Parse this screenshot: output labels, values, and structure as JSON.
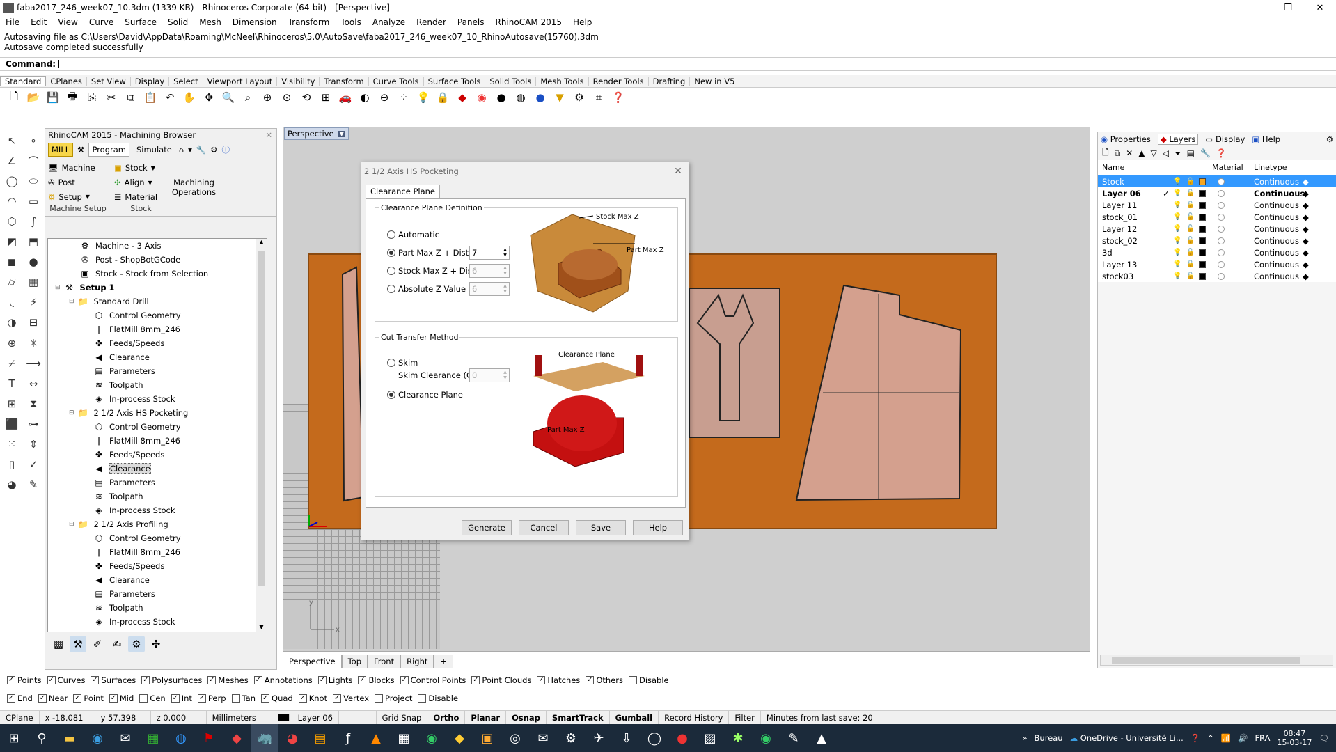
{
  "window": {
    "title": "faba2017_246_week07_10.3dm (1339 KB) - Rhinoceros Corporate (64-bit) - [Perspective]",
    "minimize": "—",
    "restore": "❐",
    "close": "✕"
  },
  "menu": [
    "File",
    "Edit",
    "View",
    "Curve",
    "Surface",
    "Solid",
    "Mesh",
    "Dimension",
    "Transform",
    "Tools",
    "Analyze",
    "Render",
    "Panels",
    "RhinoCAM 2015",
    "Help"
  ],
  "command_history": [
    "Autosaving file as C:\\Users\\David\\AppData\\Roaming\\McNeel\\Rhinoceros\\5.0\\AutoSave\\faba2017_246_week07_10_RhinoAutosave(15760).3dm",
    "Autosave completed successfully"
  ],
  "command_label": "Command:",
  "toolbar_tabs": [
    "Standard",
    "CPlanes",
    "Set View",
    "Display",
    "Select",
    "Viewport Layout",
    "Visibility",
    "Transform",
    "Curve Tools",
    "Surface Tools",
    "Solid Tools",
    "Mesh Tools",
    "Render Tools",
    "Drafting",
    "New in V5"
  ],
  "browser": {
    "title": "RhinoCAM 2015 - Machining Browser",
    "mill": "MILL",
    "program": "Program",
    "simulate": "Simulate",
    "machine": "Machine",
    "post": "Post",
    "setup": "Setup",
    "stock": "Stock",
    "align": "Align",
    "material": "Material",
    "machining_operations": "Machining Operations",
    "group_setup": "Machine Setup",
    "group_stock": "Stock"
  },
  "tree": [
    {
      "indent": 2,
      "icon": "machine-icon",
      "label": "Machine - 3 Axis",
      "glyph": "⚙"
    },
    {
      "indent": 2,
      "icon": "post-icon",
      "label": "Post - ShopBotGCode",
      "glyph": "✇"
    },
    {
      "indent": 2,
      "icon": "stock-icon",
      "label": "Stock - Stock from Selection",
      "glyph": "▣"
    },
    {
      "indent": 1,
      "icon": "setup-icon",
      "label": "Setup 1",
      "bold": true,
      "glyph": "⚒"
    },
    {
      "indent": 2,
      "icon": "folder-icon",
      "label": "Standard Drill",
      "glyph": "📁"
    },
    {
      "indent": 3,
      "icon": "control-geometry-icon",
      "label": "Control Geometry",
      "glyph": "⬡"
    },
    {
      "indent": 3,
      "icon": "tool-icon",
      "label": "FlatMill 8mm_246",
      "glyph": "ǀ"
    },
    {
      "indent": 3,
      "icon": "feeds-icon",
      "label": "Feeds/Speeds",
      "glyph": "✤"
    },
    {
      "indent": 3,
      "icon": "clearance-icon",
      "label": "Clearance",
      "glyph": "◀"
    },
    {
      "indent": 3,
      "icon": "parameters-icon",
      "label": "Parameters",
      "glyph": "▤"
    },
    {
      "indent": 3,
      "icon": "toolpath-icon",
      "label": "Toolpath",
      "glyph": "≋"
    },
    {
      "indent": 3,
      "icon": "inprocess-stock-icon",
      "label": "In-process Stock",
      "glyph": "◈"
    },
    {
      "indent": 2,
      "icon": "folder-icon",
      "label": "2 1/2 Axis HS Pocketing",
      "glyph": "📁"
    },
    {
      "indent": 3,
      "icon": "control-geometry-icon",
      "label": "Control Geometry",
      "glyph": "⬡"
    },
    {
      "indent": 3,
      "icon": "tool-icon",
      "label": "FlatMill 8mm_246",
      "glyph": "ǀ"
    },
    {
      "indent": 3,
      "icon": "feeds-icon",
      "label": "Feeds/Speeds",
      "glyph": "✤"
    },
    {
      "indent": 3,
      "icon": "clearance-icon",
      "label": "Clearance",
      "glyph": "◀",
      "selected": true
    },
    {
      "indent": 3,
      "icon": "parameters-icon",
      "label": "Parameters",
      "glyph": "▤"
    },
    {
      "indent": 3,
      "icon": "toolpath-icon",
      "label": "Toolpath",
      "glyph": "≋"
    },
    {
      "indent": 3,
      "icon": "inprocess-stock-icon",
      "label": "In-process Stock",
      "glyph": "◈"
    },
    {
      "indent": 2,
      "icon": "folder-icon",
      "label": "2 1/2 Axis Profiling",
      "glyph": "📁"
    },
    {
      "indent": 3,
      "icon": "control-geometry-icon",
      "label": "Control Geometry",
      "glyph": "⬡"
    },
    {
      "indent": 3,
      "icon": "tool-icon",
      "label": "FlatMill 8mm_246",
      "glyph": "ǀ"
    },
    {
      "indent": 3,
      "icon": "feeds-icon",
      "label": "Feeds/Speeds",
      "glyph": "✤"
    },
    {
      "indent": 3,
      "icon": "clearance-icon",
      "label": "Clearance",
      "glyph": "◀"
    },
    {
      "indent": 3,
      "icon": "parameters-icon",
      "label": "Parameters",
      "glyph": "▤"
    },
    {
      "indent": 3,
      "icon": "toolpath-icon",
      "label": "Toolpath",
      "glyph": "≋"
    },
    {
      "indent": 3,
      "icon": "inprocess-stock-icon",
      "label": "In-process Stock",
      "glyph": "◈"
    }
  ],
  "viewport": {
    "title": "Perspective",
    "tabs": [
      "Perspective",
      "Top",
      "Front",
      "Right"
    ],
    "add_tab": "+",
    "axis_y": "y",
    "axis_x": "x",
    "colors": {
      "plate": "#c46a1c",
      "part": "#d4a08e"
    }
  },
  "dialog": {
    "title": "2 1/2 Axis HS Pocketing",
    "close": "✕",
    "tab": "Clearance Plane",
    "definition_legend": "Clearance Plane Definition",
    "opt_automatic": "Automatic",
    "opt_partmax": "Part Max Z + Dist",
    "opt_stockmax": "Stock Max Z + Dist",
    "opt_absolute": "Absolute Z Value",
    "val_partmax": "7",
    "val_stockmax": "6",
    "val_absolute": "6",
    "img_stock_max": "Stock Max Z",
    "img_part_max": "Part Max Z",
    "transfer_legend": "Cut Transfer Method",
    "opt_skim": "Skim",
    "skim_label": "Skim Clearance (C)",
    "val_skim": "0",
    "opt_clearance": "Clearance Plane",
    "img_clearance_plane": "Clearance Plane",
    "img_part_max2": "Part Max Z",
    "btn_generate": "Generate",
    "btn_cancel": "Cancel",
    "btn_save": "Save",
    "btn_help": "Help"
  },
  "rpanel": {
    "tabs": [
      "Properties",
      "Layers",
      "Display",
      "Help"
    ],
    "col_name": "Name",
    "col_material": "Material",
    "col_linetype": "Linetype",
    "layers": [
      {
        "name": "Stock",
        "linetype": "Continuous",
        "selected": true,
        "current": "",
        "color": "#f5a623"
      },
      {
        "name": "Layer 06",
        "linetype": "Continuous",
        "bold": true,
        "current": "✓",
        "color": "#000000"
      },
      {
        "name": "Layer 11",
        "linetype": "Continuous",
        "current": "",
        "color": "#000000"
      },
      {
        "name": "stock_01",
        "linetype": "Continuous",
        "current": "",
        "color": "#000000"
      },
      {
        "name": "Layer 12",
        "linetype": "Continuous",
        "current": "",
        "color": "#000000"
      },
      {
        "name": "stock_02",
        "linetype": "Continuous",
        "current": "",
        "color": "#000000"
      },
      {
        "name": "3d",
        "linetype": "Continuous",
        "current": "",
        "color": "#000000"
      },
      {
        "name": "Layer 13",
        "linetype": "Continuous",
        "current": "",
        "color": "#000000"
      },
      {
        "name": "stock03",
        "linetype": "Continuous",
        "current": "",
        "color": "#000000"
      }
    ]
  },
  "filters": [
    {
      "label": "Points",
      "on": true
    },
    {
      "label": "Curves",
      "on": true
    },
    {
      "label": "Surfaces",
      "on": true
    },
    {
      "label": "Polysurfaces",
      "on": true
    },
    {
      "label": "Meshes",
      "on": true
    },
    {
      "label": "Annotations",
      "on": true
    },
    {
      "label": "Lights",
      "on": true
    },
    {
      "label": "Blocks",
      "on": true
    },
    {
      "label": "Control Points",
      "on": true
    },
    {
      "label": "Point Clouds",
      "on": true
    },
    {
      "label": "Hatches",
      "on": true
    },
    {
      "label": "Others",
      "on": true
    },
    {
      "label": "Disable",
      "on": false
    }
  ],
  "osnaps": [
    {
      "label": "End",
      "on": true
    },
    {
      "label": "Near",
      "on": true
    },
    {
      "label": "Point",
      "on": true
    },
    {
      "label": "Mid",
      "on": true
    },
    {
      "label": "Cen",
      "on": false
    },
    {
      "label": "Int",
      "on": true
    },
    {
      "label": "Perp",
      "on": true
    },
    {
      "label": "Tan",
      "on": false
    },
    {
      "label": "Quad",
      "on": true
    },
    {
      "label": "Knot",
      "on": true
    },
    {
      "label": "Vertex",
      "on": true
    },
    {
      "label": "Project",
      "on": false
    },
    {
      "label": "Disable",
      "on": false
    }
  ],
  "status": {
    "cplane": "CPlane",
    "x": "x -18.081",
    "y": "y 57.398",
    "z": "z 0.000",
    "units": "Millimeters",
    "layer": "Layer 06",
    "grid_snap": "Grid Snap",
    "ortho": "Ortho",
    "planar": "Planar",
    "osnap": "Osnap",
    "smarttrack": "SmartTrack",
    "gumball": "Gumball",
    "record_history": "Record History",
    "filter": "Filter",
    "minutes": "Minutes from last save: 20"
  },
  "taskbar": {
    "bureau": "Bureau",
    "onedrive": "OneDrive - Université Li...",
    "lang": "FRA",
    "time": "08:47",
    "date": "15-03-17"
  }
}
